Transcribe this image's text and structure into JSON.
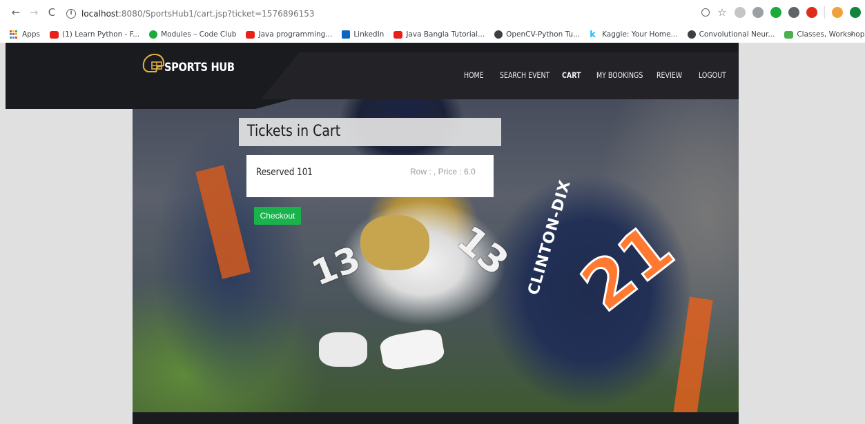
{
  "browser": {
    "url_host": "localhost",
    "url_path": ":8080/SportsHub1/cart.jsp?ticket=1576896153",
    "bookmarks": [
      {
        "label": "Apps",
        "color": ""
      },
      {
        "label": "(1) Learn Python - F...",
        "color": "#e62117"
      },
      {
        "label": "Modules – Code Club",
        "color": "#1aab3a"
      },
      {
        "label": "Java programming...",
        "color": "#e62117"
      },
      {
        "label": "LinkedIn",
        "color": "#0a66c2"
      },
      {
        "label": "Java Bangla Tutorial...",
        "color": "#e62117"
      },
      {
        "label": "OpenCV-Python Tu...",
        "color": "#3c4043"
      },
      {
        "label": "Kaggle: Your Home...",
        "color": "#20beff"
      },
      {
        "label": "Convolutional Neur...",
        "color": "#3c4043"
      },
      {
        "label": "Classes, Workshops...",
        "color": "#4caf50"
      }
    ],
    "more_label": "»"
  },
  "site": {
    "brand": "SPORTS HUB",
    "nav": [
      "HOME",
      "SEARCH EVENT",
      "CART",
      "MY BOOKINGS",
      "REVIEW",
      "LOGOUT"
    ],
    "active_nav": "CART"
  },
  "cart": {
    "title": "Tickets in Cart",
    "items": [
      {
        "name": "Reserved 101",
        "meta": "Row : , Price : 6.0"
      }
    ],
    "checkout_label": "Checkout"
  },
  "hero": {
    "jersey_numbers": [
      "13",
      "21"
    ],
    "jersey_name": "CLINTON-DIX"
  },
  "colors": {
    "header_bg": "#1a1b1f",
    "checkout_bg": "#19b34c",
    "page_bg": "#e0e0e0"
  }
}
